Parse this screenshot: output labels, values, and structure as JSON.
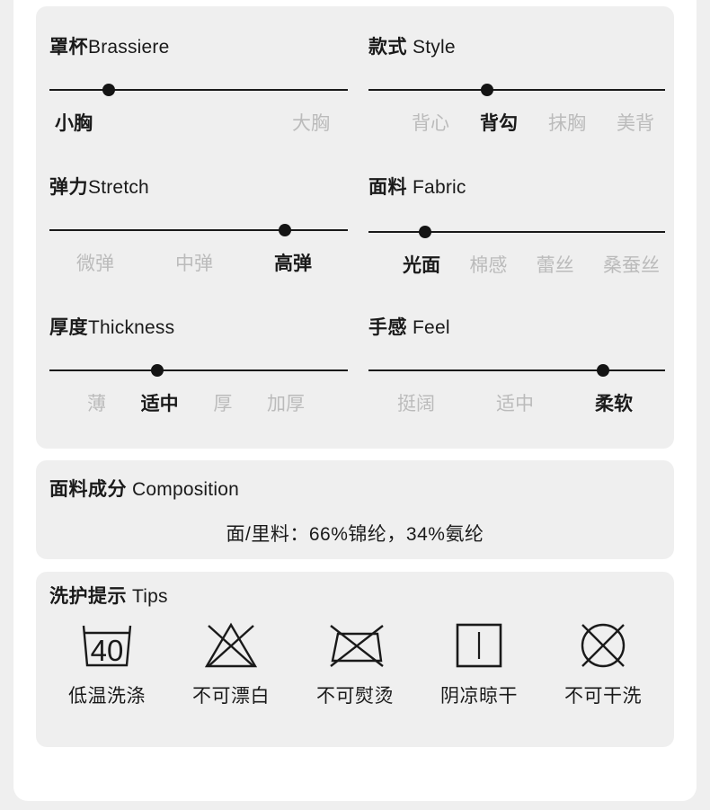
{
  "attributes": [
    {
      "title_cn": "罩杯",
      "title_en": "Brassiere",
      "knob_percent": 20,
      "options": [
        {
          "label": "小胸",
          "active": true
        },
        {
          "label": "大胸",
          "active": false
        }
      ]
    },
    {
      "title_cn": "款式",
      "title_en": " Style",
      "knob_percent": 40,
      "options": [
        {
          "label": "背心",
          "active": false
        },
        {
          "label": "背勾",
          "active": true
        },
        {
          "label": "抹胸",
          "active": false
        },
        {
          "label": "美背",
          "active": false
        }
      ]
    },
    {
      "title_cn": "弹力",
      "title_en": "Stretch",
      "knob_percent": 79,
      "options": [
        {
          "label": "微弹",
          "active": false
        },
        {
          "label": "中弹",
          "active": false
        },
        {
          "label": "高弹",
          "active": true
        }
      ]
    },
    {
      "title_cn": "面料",
      "title_en": " Fabric",
      "knob_percent": 19,
      "options": [
        {
          "label": "光面",
          "active": true
        },
        {
          "label": "棉感",
          "active": false
        },
        {
          "label": "蕾丝",
          "active": false
        },
        {
          "label": "桑蚕丝",
          "active": false
        }
      ]
    },
    {
      "title_cn": "厚度",
      "title_en": "Thickness",
      "knob_percent": 36,
      "options": [
        {
          "label": "薄",
          "active": false
        },
        {
          "label": "适中",
          "active": true
        },
        {
          "label": "厚",
          "active": false
        },
        {
          "label": "加厚",
          "active": false
        }
      ]
    },
    {
      "title_cn": "手感",
      "title_en": " Feel",
      "knob_percent": 79,
      "options": [
        {
          "label": "挺阔",
          "active": false
        },
        {
          "label": "适中",
          "active": false
        },
        {
          "label": "柔软",
          "active": true
        }
      ]
    }
  ],
  "composition": {
    "title_cn": "面料成分",
    "title_en": " Composition",
    "value": "面/里料：66%锦纶，34%氨纶"
  },
  "tips": {
    "title_cn": "洗护提示",
    "title_en": " Tips",
    "items": [
      {
        "icon": "wash-40-icon",
        "label": "低温洗涤"
      },
      {
        "icon": "do-not-bleach-icon",
        "label": "不可漂白"
      },
      {
        "icon": "do-not-iron-icon",
        "label": "不可熨烫"
      },
      {
        "icon": "dry-in-shade-icon",
        "label": "阴凉晾干"
      },
      {
        "icon": "do-not-dryclean-icon",
        "label": "不可干洗"
      }
    ]
  },
  "colors": {
    "page_background": "#efefef",
    "panel_background": "#ffffff",
    "card_background": "#efefef",
    "text_active": "#1a1a1a",
    "text_inactive": "#bbbbbb"
  }
}
